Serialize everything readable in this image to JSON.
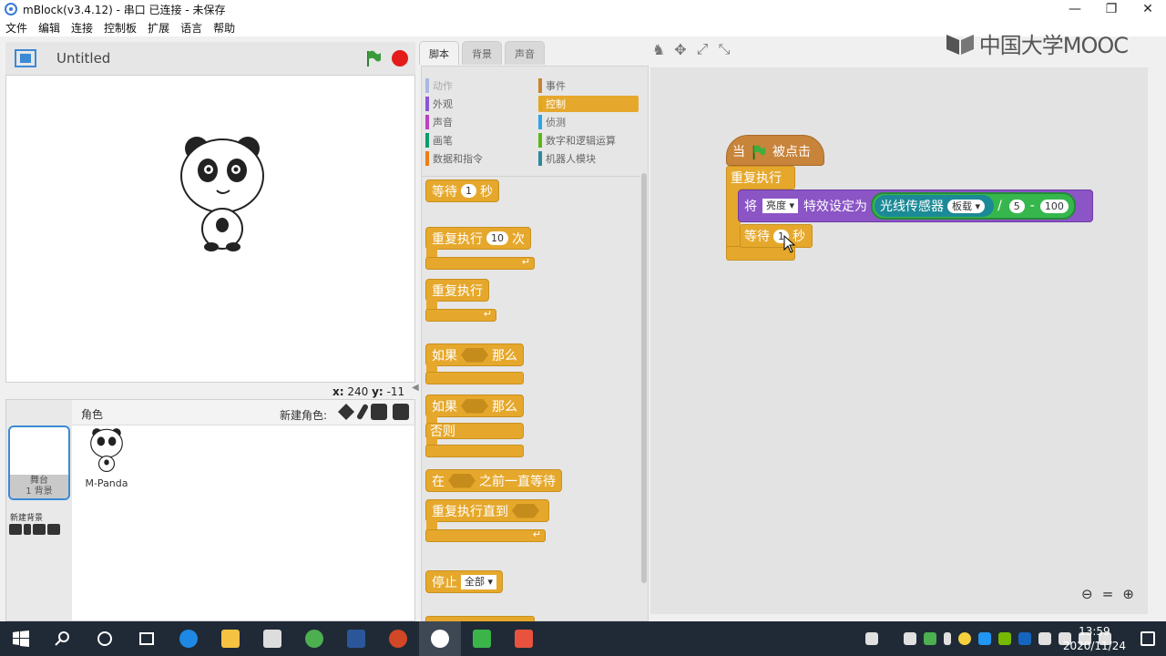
{
  "window": {
    "title": "mBlock(v3.4.12) - 串口 已连接 - 未保存",
    "controls": [
      "minimize-icon",
      "restore-icon",
      "close-icon"
    ]
  },
  "menu": [
    "文件",
    "编辑",
    "连接",
    "控制板",
    "扩展",
    "语言",
    "帮助"
  ],
  "watermark": {
    "text": "中国大学MOOC"
  },
  "stage": {
    "title": "Untitled",
    "coords": {
      "x_label": "x:",
      "x": "240",
      "y_label": "y:",
      "y": "-11"
    }
  },
  "sprites": {
    "header": "角色",
    "new_sprite": "新建角色:",
    "stage_label": "舞台",
    "stage_backdrops": "1 背景",
    "new_backdrop": "新建背景",
    "items": [
      {
        "name": "M-Panda"
      }
    ]
  },
  "tabs": [
    {
      "label": "脚本",
      "active": true
    },
    {
      "label": "背景",
      "active": false
    },
    {
      "label": "声音",
      "active": false
    }
  ],
  "categories": [
    {
      "label": "动作",
      "color": "#4a6cd4"
    },
    {
      "label": "外观",
      "color": "#8a55d7"
    },
    {
      "label": "声音",
      "color": "#bb42c3"
    },
    {
      "label": "画笔",
      "color": "#0e9a6c"
    },
    {
      "label": "数据和指令",
      "color": "#ee7d16"
    },
    {
      "label": "事件",
      "color": "#c88330"
    },
    {
      "label": "控制",
      "color": "#e1a91a",
      "selected": true
    },
    {
      "label": "侦测",
      "color": "#2ca5e2"
    },
    {
      "label": "数字和逻辑运算",
      "color": "#5cb712"
    },
    {
      "label": "机器人模块",
      "color": "#2e8a9a"
    }
  ],
  "palette_blocks": {
    "wait": {
      "label": "等待",
      "value": "1",
      "unit": "秒"
    },
    "repeat": {
      "label": "重复执行",
      "value": "10",
      "unit": "次"
    },
    "forever": {
      "label": "重复执行"
    },
    "if_then": {
      "label1": "如果",
      "label2": "那么"
    },
    "if_else": {
      "label1": "如果",
      "label2": "那么",
      "else": "否则"
    },
    "wait_until": {
      "label1": "在",
      "label2": "之前一直等待"
    },
    "repeat_until": {
      "label": "重复执行直到"
    },
    "stop": {
      "label": "停止",
      "option": "全部"
    }
  },
  "script": {
    "hat": {
      "label1": "当",
      "label2": "被点击"
    },
    "forever": {
      "label": "重复执行"
    },
    "effect": {
      "label1": "将",
      "effect": "亮度",
      "label2": "特效设定为",
      "sensor": "光线传感器",
      "port": "板载",
      "op1": "/",
      "divisor": "5",
      "op2": "-",
      "value": "100"
    },
    "wait": {
      "label": "等待",
      "value": "1",
      "unit": "秒"
    }
  },
  "taskbar": {
    "time": "13:59",
    "date": "2020/11/24"
  },
  "colors": {
    "control": "#e6a82c",
    "events": "#c8843b",
    "looks": "#8b55c6",
    "robot": "#1b8a96"
  }
}
